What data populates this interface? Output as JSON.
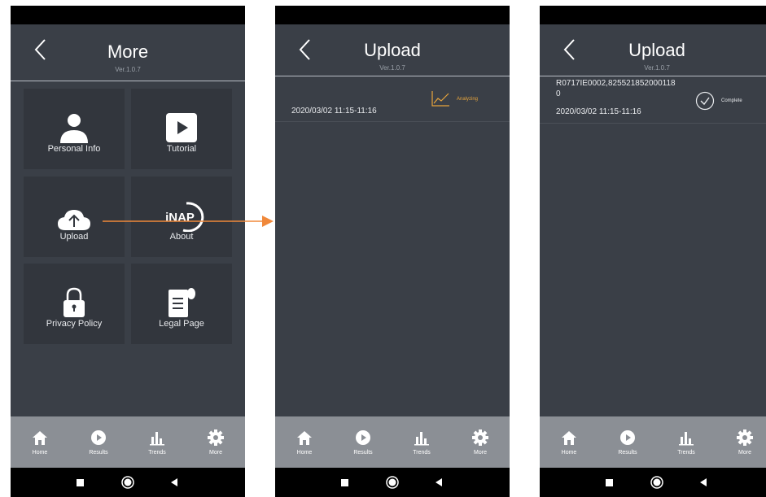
{
  "screens": [
    {
      "title": "More",
      "version": "Ver.1.0.7",
      "tiles": [
        {
          "label": "Personal Info",
          "icon": "person-icon"
        },
        {
          "label": "Tutorial",
          "icon": "play-icon"
        },
        {
          "label": "Upload",
          "icon": "cloud-upload-icon"
        },
        {
          "label": "About",
          "icon": "inap-logo-icon",
          "logo_text": "iNAP"
        },
        {
          "label": "Privacy Policy",
          "icon": "lock-icon"
        },
        {
          "label": "Legal Page",
          "icon": "document-icon"
        }
      ]
    },
    {
      "title": "Upload",
      "version": "Ver.1.0.7",
      "record": {
        "datetime": "2020/03/02 11:15-11:16",
        "status": "Analyzing",
        "status_icon": "line-chart-icon"
      }
    },
    {
      "title": "Upload",
      "version": "Ver.1.0.7",
      "record": {
        "id_line1": "R0717IE0002,825521852000118",
        "id_line2": "0",
        "datetime": "2020/03/02 11:15-11:16",
        "status": "Complete",
        "status_icon": "check-circle-icon"
      }
    }
  ],
  "tabbar": [
    {
      "label": "Home",
      "icon": "home-icon"
    },
    {
      "label": "Results",
      "icon": "results-play-icon"
    },
    {
      "label": "Trends",
      "icon": "bar-chart-icon"
    },
    {
      "label": "More",
      "icon": "gear-icon"
    }
  ],
  "system_nav": [
    "stop-square-icon",
    "home-circle-icon",
    "back-triangle-icon"
  ],
  "colors": {
    "background": "#3a3f47",
    "tile": "#32363d",
    "tabbar": "#8b8f95",
    "accent": "#e8a53c",
    "arrow": "#f0883a"
  }
}
